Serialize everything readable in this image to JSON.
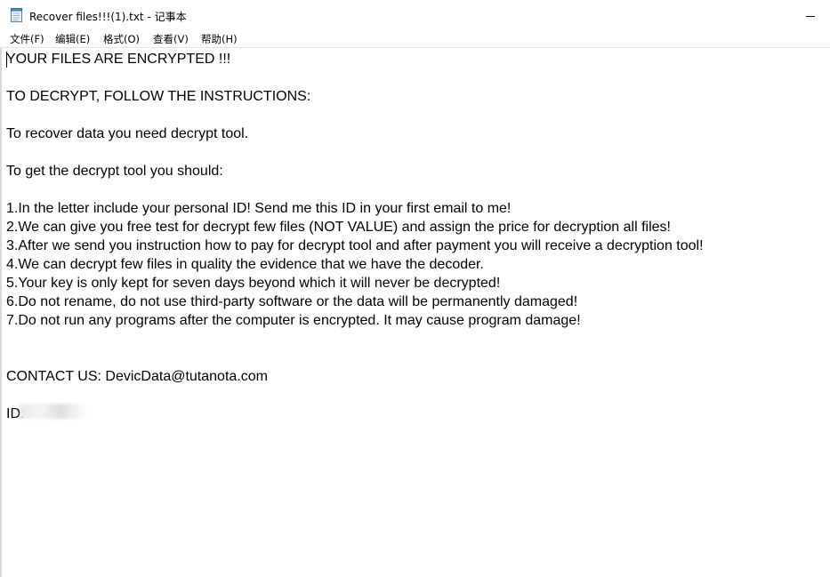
{
  "window": {
    "title": "Recover files!!!(1).txt - 记事本",
    "icon": "notepad-icon"
  },
  "menu": [
    {
      "label": "文件(F)"
    },
    {
      "label": "编辑(E)"
    },
    {
      "label": "格式(O)"
    },
    {
      "label": "查看(V)"
    },
    {
      "label": "帮助(H)"
    }
  ],
  "document": {
    "lines": [
      "YOUR FILES ARE ENCRYPTED !!!",
      "",
      "TO DECRYPT, FOLLOW THE INSTRUCTIONS:",
      "",
      "To recover data you need decrypt tool.",
      "",
      "To get the decrypt tool you should:",
      "",
      "1.In the letter include your personal ID! Send me this ID in your first email to me!",
      "2.We can give you free test for decrypt few files (NOT VALUE) and assign the price for decryption all files!",
      "3.After we send you instruction how to pay for decrypt tool and after payment you will receive a decryption tool!",
      "4.We can decrypt few files in quality the evidence that we have the decoder.",
      "5.Your key is only kept for seven days beyond which it will never be decrypted!",
      "6.Do not rename, do not use third-party software or the data will be permanently damaged!",
      "7.Do not run any programs after the computer is encrypted. It may cause program damage!",
      "",
      "",
      "CONTACT US: DevicData@tutanota.com",
      "",
      "ID:"
    ]
  }
}
